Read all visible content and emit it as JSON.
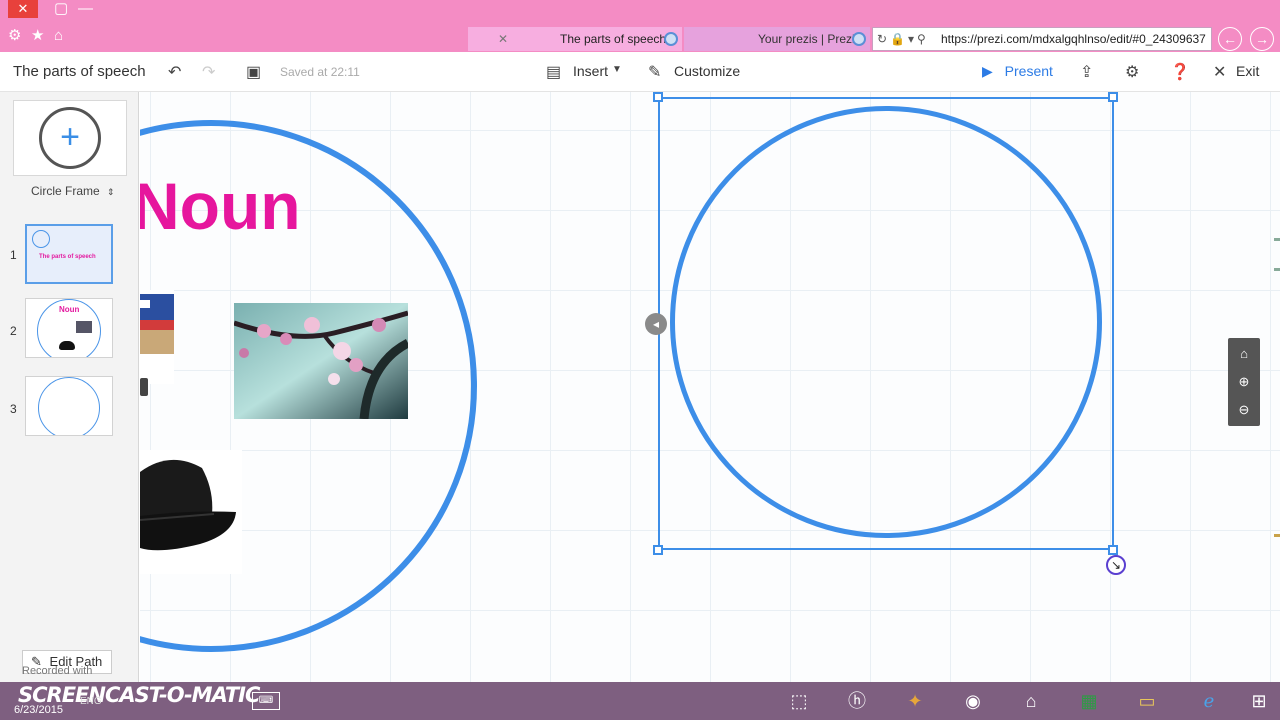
{
  "browser": {
    "close_icon": "✕",
    "tabs": [
      {
        "label": "The parts of speech",
        "active": true
      },
      {
        "label": "Your prezis | Prezi",
        "active": false
      }
    ],
    "tab_close": "✕",
    "address": "https://prezi.com/mdxalgqhlnso/edit/#0_24309637"
  },
  "toolbar": {
    "title": "The parts of speech",
    "saved": "Saved at 22:11",
    "insert": "Insert",
    "customize": "Customize",
    "present": "Present",
    "exit": "Exit"
  },
  "sidebar": {
    "frame_type": "Circle Frame",
    "slides": [
      {
        "number": "1",
        "title": "The parts of speech"
      },
      {
        "number": "2",
        "title": "Noun"
      },
      {
        "number": "3",
        "title": ""
      }
    ],
    "edit_path": "Edit Path"
  },
  "canvas": {
    "heading": "Noun"
  },
  "taskbar": {
    "recorded": "Recorded with",
    "brand": "SCREENCAST-O-MATIC",
    "date": "6/23/2015",
    "lang": "ENG"
  },
  "colors": {
    "browser_bg": "#f48cc4",
    "accent": "#3d8ee8",
    "noun_pink": "#e6169d",
    "taskbar": "#7e5f80"
  }
}
